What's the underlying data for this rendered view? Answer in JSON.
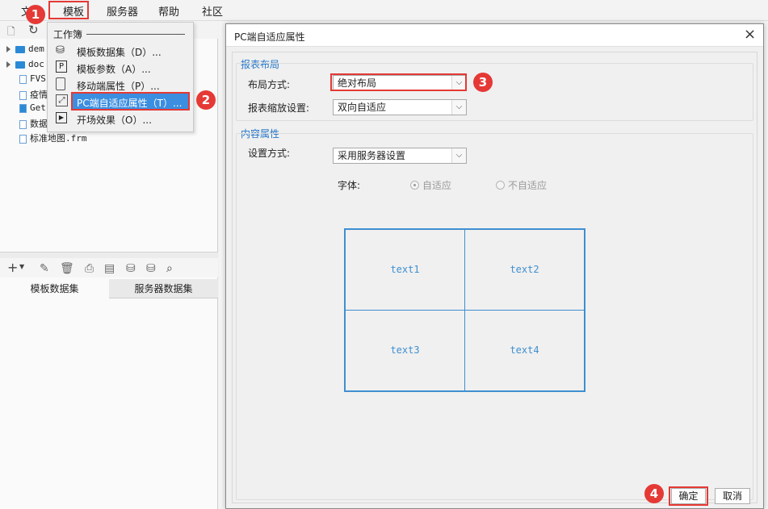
{
  "menubar": {
    "items": [
      "文",
      "模板",
      "服务器",
      "帮助",
      "社区"
    ]
  },
  "dropdown": {
    "header": "工作簿",
    "items": [
      {
        "label": "模板数据集（D）...",
        "icon": "database-icon"
      },
      {
        "label": "模板参数（A）...",
        "icon": "parameter-icon"
      },
      {
        "label": "移动端属性（P）...",
        "icon": "mobile-icon"
      },
      {
        "label": "PC端自适应属性（T）...",
        "icon": "expand-icon"
      },
      {
        "label": "开场效果（O）...",
        "icon": "play-icon"
      }
    ]
  },
  "tree": {
    "items": [
      {
        "label": "dem",
        "type": "folder"
      },
      {
        "label": "doc",
        "type": "folder"
      },
      {
        "label": "FVS",
        "type": "file"
      },
      {
        "label": "疫情",
        "type": "file"
      },
      {
        "label": "Get",
        "type": "file"
      },
      {
        "label": "数据",
        "type": "file"
      },
      {
        "label": "标准地图.frm",
        "type": "file"
      }
    ]
  },
  "dataset_tabs": {
    "tab1": "模板数据集",
    "tab2": "服务器数据集"
  },
  "callouts": [
    "1",
    "2",
    "3",
    "4"
  ],
  "dialog": {
    "title": "PC端自适应属性",
    "close": "×",
    "section_layout": "报表布局",
    "layout_label": "布局方式:",
    "layout_value": "绝对布局",
    "zoom_label": "报表缩放设置:",
    "zoom_value": "双向自适应",
    "section_content": "内容属性",
    "setting_label": "设置方式:",
    "setting_value": "采用服务器设置",
    "font_label": "字体:",
    "radio_adaptive": "自适应",
    "radio_non_adaptive": "不自适应",
    "cells": [
      "text1",
      "text2",
      "text3",
      "text4"
    ],
    "ok": "确定",
    "cancel": "取消"
  },
  "colors": {
    "accent": "#1f73c8",
    "callout": "#e53935",
    "selected": "#3b8ee0"
  }
}
